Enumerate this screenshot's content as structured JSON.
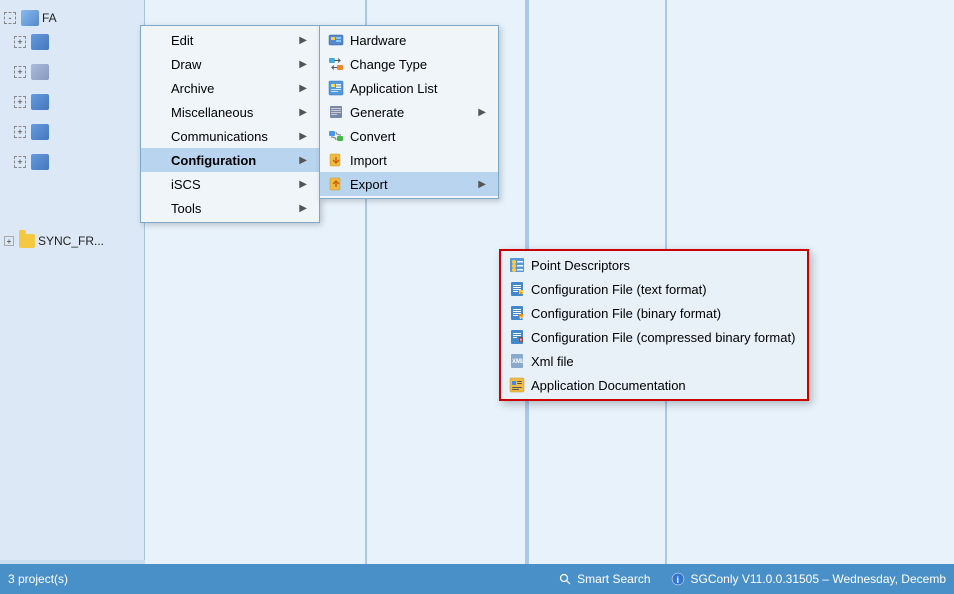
{
  "app": {
    "title": "FA"
  },
  "status_bar": {
    "projects": "3 project(s)",
    "smart_search": "Smart Search",
    "version": "SGConly   V11.0.0.31505 – Wednesday, Decemb"
  },
  "tree": {
    "items": [
      {
        "label": "FA",
        "type": "root"
      },
      {
        "label": "SYNC_FR...",
        "type": "folder"
      }
    ]
  },
  "main_menu": {
    "items": [
      {
        "label": "Edit",
        "has_arrow": true
      },
      {
        "label": "Draw",
        "has_arrow": true
      },
      {
        "label": "Archive",
        "has_arrow": true
      },
      {
        "label": "Miscellaneous",
        "has_arrow": true
      },
      {
        "label": "Communications",
        "has_arrow": true
      },
      {
        "label": "Configuration",
        "has_arrow": true,
        "active": true
      },
      {
        "label": "iSCS",
        "has_arrow": true
      },
      {
        "label": "Tools",
        "has_arrow": true
      }
    ]
  },
  "config_submenu": {
    "items": [
      {
        "label": "Hardware",
        "icon": "grid",
        "has_arrow": false
      },
      {
        "label": "Change Type",
        "icon": "arrows",
        "has_arrow": false
      },
      {
        "label": "Application List",
        "icon": "list",
        "has_arrow": false
      },
      {
        "label": "Generate",
        "icon": "gear",
        "has_arrow": true
      },
      {
        "label": "Convert",
        "icon": "convert",
        "has_arrow": false
      },
      {
        "label": "Import",
        "icon": "import",
        "has_arrow": false
      },
      {
        "label": "Export",
        "icon": "export",
        "has_arrow": true,
        "active": true
      }
    ]
  },
  "export_submenu": {
    "items": [
      {
        "label": "Point Descriptors",
        "icon": "points"
      },
      {
        "label": "Configuration File (text format)",
        "icon": "config_text"
      },
      {
        "label": "Configuration File (binary format)",
        "icon": "config_bin"
      },
      {
        "label": "Configuration File (compressed binary format)",
        "icon": "config_cbf"
      },
      {
        "label": "Xml file",
        "icon": "xml"
      },
      {
        "label": "Application Documentation",
        "icon": "app_doc"
      }
    ]
  }
}
